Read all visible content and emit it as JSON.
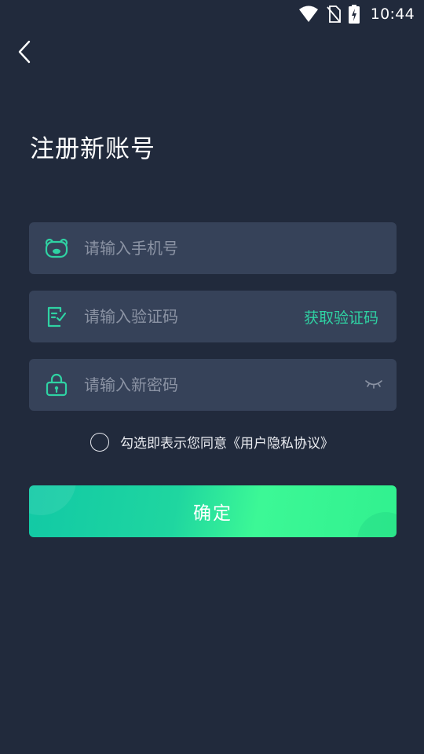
{
  "status_bar": {
    "time": "10:44",
    "icons": [
      "wifi-icon",
      "no-sim-icon",
      "battery-charging-icon"
    ]
  },
  "header": {
    "back_icon": "chevron-left-icon",
    "title": "注册新账号"
  },
  "form": {
    "phone": {
      "icon": "bear-icon",
      "placeholder": "请输入手机号",
      "value": ""
    },
    "code": {
      "icon": "clipboard-check-icon",
      "placeholder": "请输入验证码",
      "value": "",
      "get_code_label": "获取验证码"
    },
    "password": {
      "icon": "lock-icon",
      "placeholder": "请输入新密码",
      "value": "",
      "toggle_icon": "eye-closed-icon"
    }
  },
  "agreement": {
    "checked": false,
    "text": "勾选即表示您同意",
    "link": "《用户隐私协议》"
  },
  "confirm_label": "确定",
  "colors": {
    "background": "#212a3c",
    "field_bg": "#364259",
    "accent": "#2fd2a3",
    "button_start": "#12c9a5",
    "button_end": "#3cf896",
    "placeholder": "#8b93a4"
  }
}
